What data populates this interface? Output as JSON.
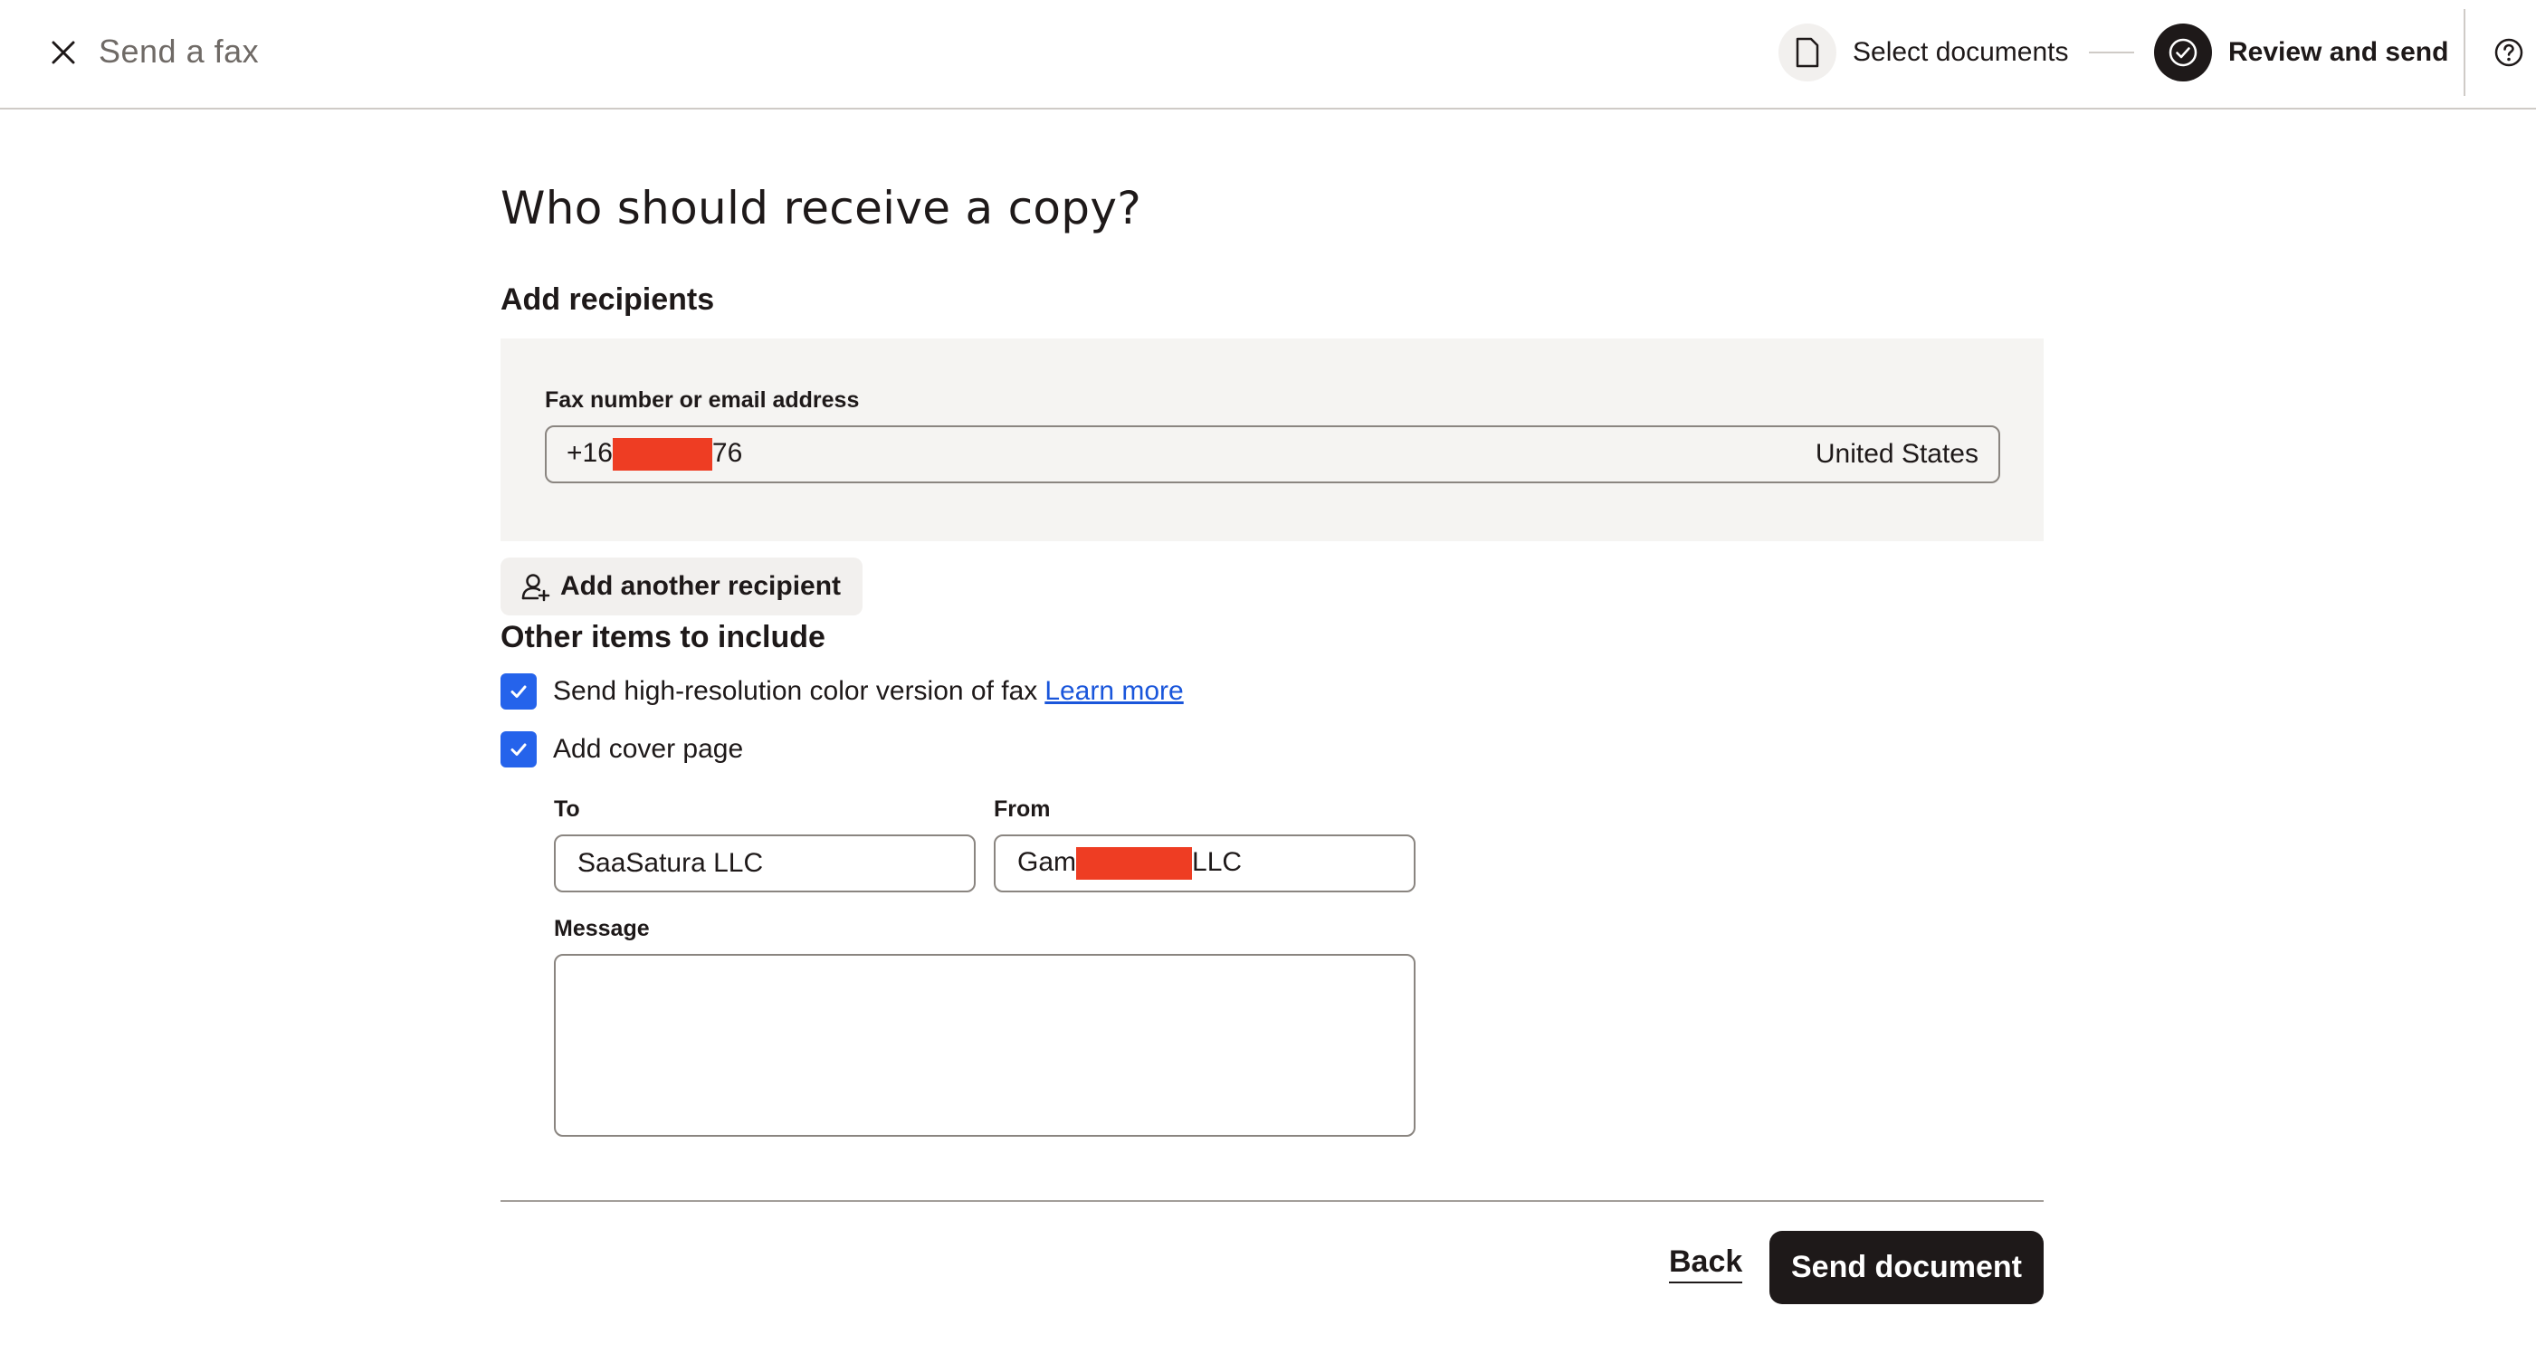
{
  "header": {
    "title": "Send a fax",
    "close_icon": "close-icon",
    "steps": [
      {
        "label": "Select documents",
        "icon": "document-icon",
        "state": "complete"
      },
      {
        "label": "Review and send",
        "icon": "check-circle-icon",
        "state": "current"
      }
    ],
    "help_icon": "help-icon"
  },
  "main": {
    "heading": "Who should receive a copy?",
    "add_recipients_label": "Add recipients",
    "recipient": {
      "field_label": "Fax number or email address",
      "value_prefix": "+16",
      "value_suffix": "76",
      "country": "United States"
    },
    "add_another_label": "Add another recipient",
    "other_items_title": "Other items to include",
    "options": [
      {
        "label": "Send high-resolution color version of fax",
        "checked": true,
        "link": "Learn more"
      },
      {
        "label": "Add cover page",
        "checked": true
      }
    ],
    "cover": {
      "to_label": "To",
      "to_value": "SaaSatura LLC",
      "from_label": "From",
      "from_prefix": "Gam",
      "from_suffix": "LLC",
      "message_label": "Message",
      "message_value": ""
    }
  },
  "footer": {
    "back_label": "Back",
    "send_label": "Send document"
  },
  "colors": {
    "accent": "#2563eb",
    "primary_button": "#1e1919",
    "redaction": "#ee3d23",
    "panel_bg": "#f5f4f2"
  }
}
